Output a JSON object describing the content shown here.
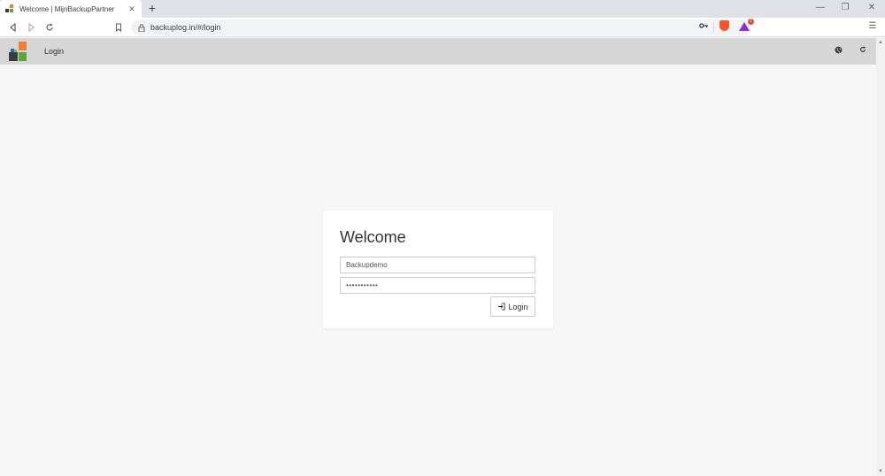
{
  "browser": {
    "tab": {
      "title": "Welcome | MijnBackupPartner",
      "close_glyph": "✕"
    },
    "new_tab_glyph": "+",
    "window_controls": {
      "minimize": "—",
      "restore": "❐",
      "close": "✕"
    },
    "url": "backuplog.in/#/login",
    "rewards_badge": "1",
    "menu_glyph": "☰"
  },
  "app": {
    "nav": {
      "login_label": "Login"
    },
    "header_icons": {
      "globe": "globe-icon",
      "refresh": "refresh-icon"
    },
    "logo_colors": {
      "orange": "#f07f3c",
      "green": "#5ea43a",
      "dark": "#3b3b3b",
      "blue": "#1a73b8",
      "lime": "#7bbf44"
    }
  },
  "login": {
    "title": "Welcome",
    "username_value": "Backupdemo",
    "password_value": "•••••••••••",
    "button_label": "Login"
  }
}
